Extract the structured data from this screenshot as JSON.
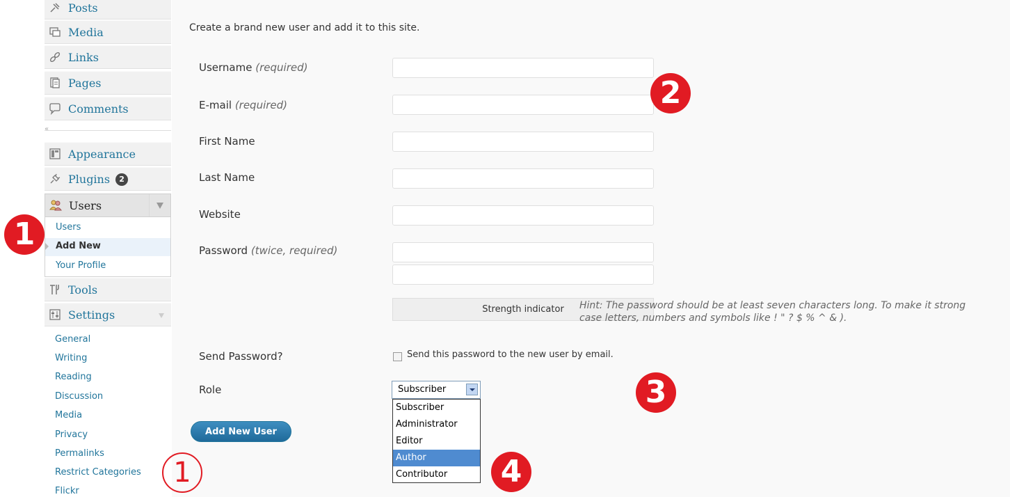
{
  "sidebar": {
    "menu": [
      {
        "label": "Posts",
        "icon": "pushpin-icon"
      },
      {
        "label": "Media",
        "icon": "media-icon"
      },
      {
        "label": "Links",
        "icon": "link-icon"
      },
      {
        "label": "Pages",
        "icon": "pages-icon"
      },
      {
        "label": "Comments",
        "icon": "comment-icon"
      },
      {
        "label": "Appearance",
        "icon": "appearance-icon"
      },
      {
        "label": "Plugins",
        "icon": "plugin-icon",
        "badge": "2"
      },
      {
        "label": "Users",
        "icon": "users-icon"
      },
      {
        "label": "Tools",
        "icon": "tools-icon"
      },
      {
        "label": "Settings",
        "icon": "settings-icon"
      }
    ],
    "collapse_glyph": "«",
    "users_sub": [
      "Users",
      "Add New",
      "Your Profile"
    ],
    "settings_sub": [
      "General",
      "Writing",
      "Reading",
      "Discussion",
      "Media",
      "Privacy",
      "Permalinks",
      "Restrict Categories",
      "Flickr"
    ]
  },
  "form": {
    "intro": "Create a brand new user and add it to this site.",
    "fields": [
      {
        "label": "Username",
        "note": "(required)",
        "value": ""
      },
      {
        "label": "E-mail",
        "note": "(required)",
        "value": ""
      },
      {
        "label": "First Name",
        "note": "",
        "value": ""
      },
      {
        "label": "Last Name",
        "note": "",
        "value": ""
      },
      {
        "label": "Website",
        "note": "",
        "value": ""
      },
      {
        "label": "Password",
        "note": "(twice, required)",
        "value": ""
      }
    ],
    "strength": "Strength indicator",
    "hint_line1": "Hint: The password should be at least seven characters long. To make it strong",
    "hint_line2": "case letters, numbers and symbols like ! \" ? $ % ^ & ).",
    "send_password_label": "Send Password?",
    "send_password_text": "Send this password to the new user by email.",
    "role_label": "Role",
    "role_value": "Subscriber",
    "role_options": [
      "Subscriber",
      "Administrator",
      "Editor",
      "Author",
      "Contributor"
    ],
    "role_highlighted": "Author",
    "submit": "Add New User"
  },
  "callouts": [
    "1",
    "2",
    "3",
    "4",
    "1"
  ],
  "colors": {
    "accent": "#21759b",
    "callout": "#e11b23",
    "highlight": "#4f8bd0"
  }
}
